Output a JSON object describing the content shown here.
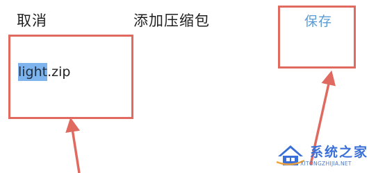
{
  "header": {
    "cancel_label": "取消",
    "title": "添加压缩包",
    "save_label": "保存"
  },
  "file": {
    "name_selected": "light",
    "name_rest": ".zip"
  },
  "watermark": {
    "brand": "系统之家",
    "url": "XITONGZHIJIA.NET"
  },
  "colors": {
    "save_text": "#5b9bd5",
    "selection": "#7db4ee",
    "annotation": "#e06a5f",
    "watermark_blue": "#3a6fd8"
  }
}
